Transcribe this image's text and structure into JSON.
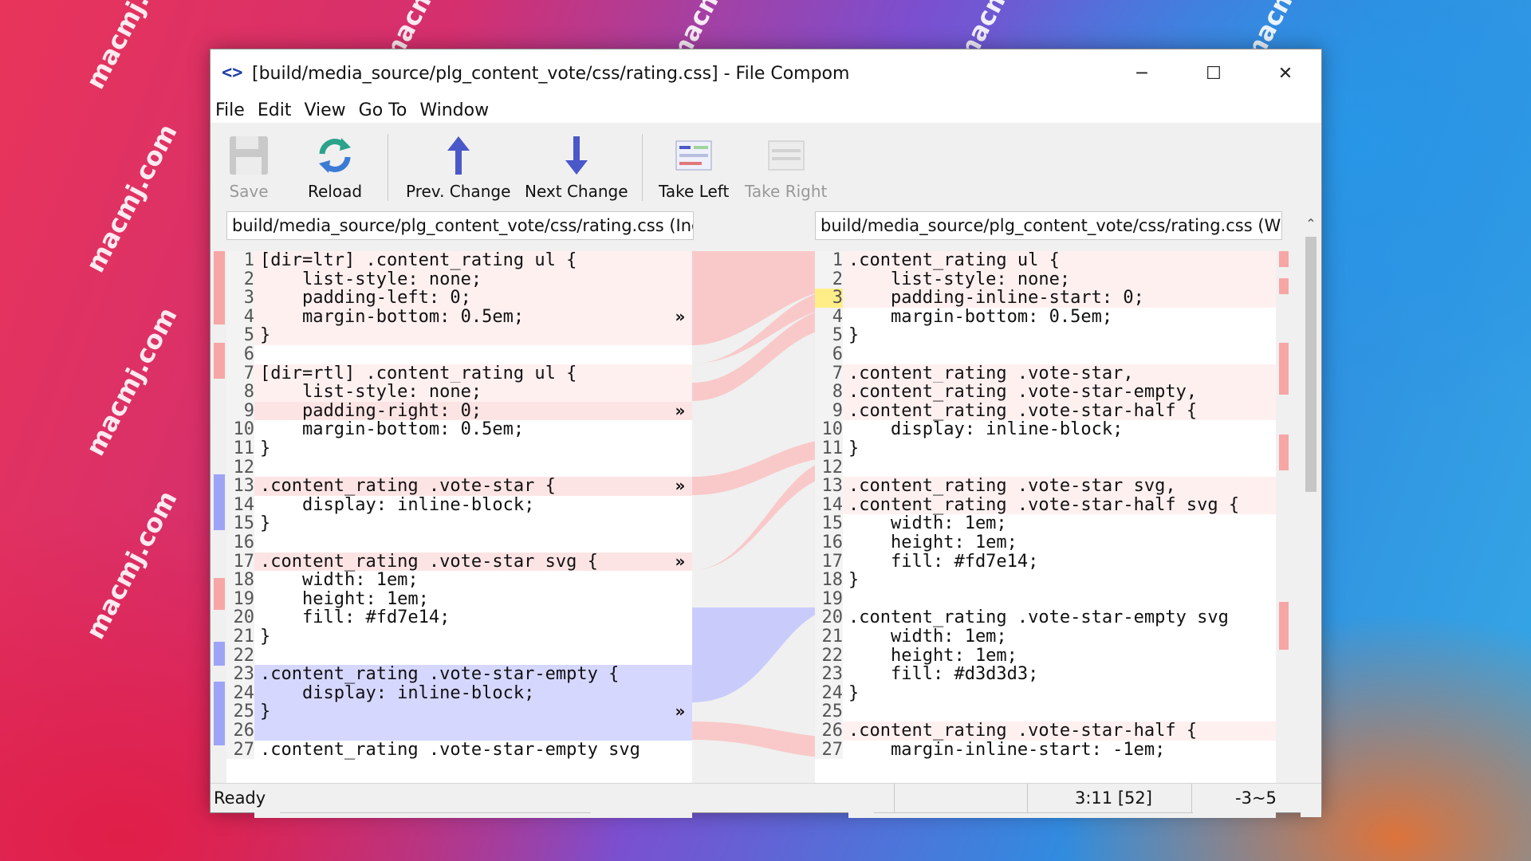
{
  "watermark": "macmj.com",
  "window": {
    "title": "[build/media_source/plg_content_vote/css/rating.css] - File Compom",
    "icon": "compare-icon",
    "controls": {
      "minimize": "─",
      "maximize": "☐",
      "close": "✕"
    }
  },
  "menu": [
    "File",
    "Edit",
    "View",
    "Go To",
    "Window"
  ],
  "toolbar": {
    "save": "Save",
    "reload": "Reload",
    "prev_change": "Prev. Change",
    "next_change": "Next Change",
    "take_left": "Take Left",
    "take_right": "Take Right"
  },
  "left_path": "build/media_source/plg_content_vote/css/rating.css (Inc",
  "right_path": "build/media_source/plg_content_vote/css/rating.css (Wc",
  "left_lines": [
    {
      "n": "1",
      "t": "[dir=ltr] .content_rating ul {"
    },
    {
      "n": "2",
      "t": "    list-style: none;"
    },
    {
      "n": "3",
      "t": "    padding-left: 0;"
    },
    {
      "n": "4",
      "t": "    margin-bottom: 0.5em;"
    },
    {
      "n": "5",
      "t": "}"
    },
    {
      "n": "6",
      "t": ""
    },
    {
      "n": "7",
      "t": "[dir=rtl] .content_rating ul {"
    },
    {
      "n": "8",
      "t": "    list-style: none;"
    },
    {
      "n": "9",
      "t": "    padding-right: 0;"
    },
    {
      "n": "10",
      "t": "    margin-bottom: 0.5em;"
    },
    {
      "n": "11",
      "t": "}"
    },
    {
      "n": "12",
      "t": ""
    },
    {
      "n": "13",
      "t": ".content_rating .vote-star {"
    },
    {
      "n": "14",
      "t": "    display: inline-block;"
    },
    {
      "n": "15",
      "t": "}"
    },
    {
      "n": "16",
      "t": ""
    },
    {
      "n": "17",
      "t": ".content_rating .vote-star svg {"
    },
    {
      "n": "18",
      "t": "    width: 1em;"
    },
    {
      "n": "19",
      "t": "    height: 1em;"
    },
    {
      "n": "20",
      "t": "    fill: #fd7e14;"
    },
    {
      "n": "21",
      "t": "}"
    },
    {
      "n": "22",
      "t": ""
    },
    {
      "n": "23",
      "t": ".content_rating .vote-star-empty {"
    },
    {
      "n": "24",
      "t": "    display: inline-block;"
    },
    {
      "n": "25",
      "t": "}"
    },
    {
      "n": "26",
      "t": ""
    },
    {
      "n": "27",
      "t": ".content_rating .vote-star-empty svg"
    }
  ],
  "right_lines": [
    {
      "n": "1",
      "t": ".content_rating ul {"
    },
    {
      "n": "2",
      "t": "    list-style: none;"
    },
    {
      "n": "3",
      "t": "    padding-inline-start: 0;"
    },
    {
      "n": "4",
      "t": "    margin-bottom: 0.5em;"
    },
    {
      "n": "5",
      "t": "}"
    },
    {
      "n": "6",
      "t": ""
    },
    {
      "n": "7",
      "t": ".content_rating .vote-star,"
    },
    {
      "n": "8",
      "t": ".content_rating .vote-star-empty,"
    },
    {
      "n": "9",
      "t": ".content_rating .vote-star-half {"
    },
    {
      "n": "10",
      "t": "    display: inline-block;"
    },
    {
      "n": "11",
      "t": "}"
    },
    {
      "n": "12",
      "t": ""
    },
    {
      "n": "13",
      "t": ".content_rating .vote-star svg,"
    },
    {
      "n": "14",
      "t": ".content_rating .vote-star-half svg {"
    },
    {
      "n": "15",
      "t": "    width: 1em;"
    },
    {
      "n": "16",
      "t": "    height: 1em;"
    },
    {
      "n": "17",
      "t": "    fill: #fd7e14;"
    },
    {
      "n": "18",
      "t": "}"
    },
    {
      "n": "19",
      "t": ""
    },
    {
      "n": "20",
      "t": ".content_rating .vote-star-empty svg"
    },
    {
      "n": "21",
      "t": "    width: 1em;"
    },
    {
      "n": "22",
      "t": "    height: 1em;"
    },
    {
      "n": "23",
      "t": "    fill: #d3d3d3;"
    },
    {
      "n": "24",
      "t": "}"
    },
    {
      "n": "25",
      "t": ""
    },
    {
      "n": "26",
      "t": ".content_rating .vote-star-half {"
    },
    {
      "n": "27",
      "t": "    margin-inline-start: -1em;"
    }
  ],
  "take_marker": "»",
  "status": {
    "text": "Ready",
    "cursor": "3:11 [52]",
    "changes": "-3~5"
  },
  "colors": {
    "deleted": "#fde4e4",
    "moved": "#d6d7ff",
    "inserted": "#9fe89f",
    "current": "#ffee88"
  }
}
